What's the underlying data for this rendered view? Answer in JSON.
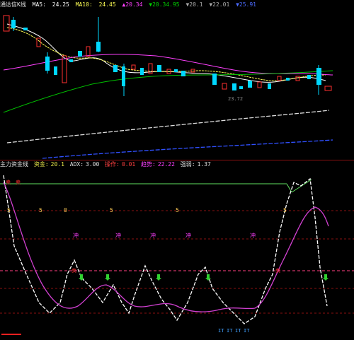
{
  "header": {
    "title": "通达信K线",
    "ma_label": "MA5:",
    "ma5": "24.25",
    "ma10_label": "MA10:",
    "ma10": "24.45",
    "vals": [
      "▲20.34",
      "▼20.34.95",
      "▼20.1",
      "▼22.01",
      "▼25.91"
    ],
    "price_small": "23.72"
  },
  "lower_legend": {
    "name": "主力资金线",
    "items": [
      {
        "label": "资金:",
        "value": "20.1",
        "color": "#e8e84a"
      },
      {
        "label": "ADX:",
        "value": "3.00",
        "color": "#e0e0e0"
      },
      {
        "label": "操作:",
        "value": "0.01",
        "color": "#ff4040"
      },
      {
        "label": "趋势:",
        "value": "22.22",
        "color": "#ff40ff"
      },
      {
        "label": "强弱:",
        "value": "1.37",
        "color": "#e0e0e0"
      }
    ]
  },
  "lower_markers": {
    "row1": [
      "5",
      "5",
      "0",
      "5",
      "5",
      "5"
    ],
    "row2": [
      "冲",
      "冲",
      "冲",
      "冲",
      "冲"
    ],
    "bottom": [
      "IT",
      "IT",
      "IT",
      "IT"
    ],
    "sell_label": "卖"
  },
  "colors": {
    "up": "#ff3030",
    "down": "#00d8ff",
    "ma5": "#ffffff",
    "ma10": "#ffff55",
    "ma20": "#ff40ff",
    "ma60": "#00c000",
    "bg": "#000000"
  }
}
